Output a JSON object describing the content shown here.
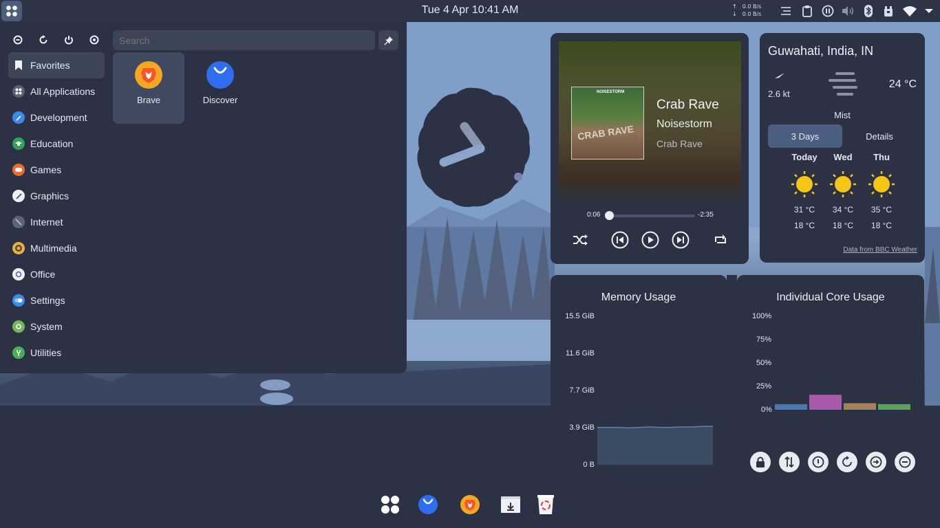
{
  "topbar": {
    "datetime": "Tue 4 Apr  10:41 AM",
    "net_up": "0.0 B/s",
    "net_down": "0.0 B/s",
    "tray_icons": [
      "notes-icon",
      "clipboard-icon",
      "media-pause-icon",
      "volume-icon",
      "bluetooth-icon",
      "package-icon",
      "wifi-icon",
      "chevron-down-icon"
    ]
  },
  "launcher": {
    "search_placeholder": "Search",
    "power_buttons": [
      "logout-icon",
      "restart-icon",
      "shutdown-icon",
      "sleep-icon"
    ],
    "categories": [
      {
        "label": "Favorites",
        "icon": "bookmark-icon",
        "color": "#e6e9ef"
      },
      {
        "label": "All Applications",
        "icon": "apps-icon",
        "color": "#7d8597"
      },
      {
        "label": "Development",
        "icon": "hammer-icon",
        "color": "#3d8be8"
      },
      {
        "label": "Education",
        "icon": "graduation-icon",
        "color": "#2fa35b"
      },
      {
        "label": "Games",
        "icon": "gamepad-icon",
        "color": "#f06a2c"
      },
      {
        "label": "Graphics",
        "icon": "brush-icon",
        "color": "#e6e9ef"
      },
      {
        "label": "Internet",
        "icon": "globe-icon",
        "color": "#5c667a"
      },
      {
        "label": "Multimedia",
        "icon": "speaker-icon",
        "color": "#e6b34a"
      },
      {
        "label": "Office",
        "icon": "office-icon",
        "color": "#e6e9ef"
      },
      {
        "label": "Settings",
        "icon": "toggle-icon",
        "color": "#3d8be8"
      },
      {
        "label": "System",
        "icon": "gear-icon",
        "color": "#72b85a"
      },
      {
        "label": "Utilities",
        "icon": "wrench-icon",
        "color": "#4aae58"
      }
    ],
    "apps": [
      {
        "label": "Brave",
        "icon": "brave-icon"
      },
      {
        "label": "Discover",
        "icon": "discover-icon"
      }
    ]
  },
  "music": {
    "title": "Crab Rave",
    "artist": "Noisestorm",
    "album": "Crab Rave",
    "cover_brand": "NOISESTORM",
    "cover_text": "CRAB RAVE",
    "elapsed": "0:06",
    "remaining": "-2:35",
    "progress": 0.04
  },
  "weather": {
    "location": "Guwahati, India, IN",
    "wind": "2.6 kt",
    "temperature": "24 °C",
    "condition": "Mist",
    "tabs": [
      "3 Days",
      "Details"
    ],
    "days": [
      {
        "name": "Today",
        "hi": "31 °C",
        "lo": "18 °C"
      },
      {
        "name": "Wed",
        "hi": "34 °C",
        "lo": "18 °C"
      },
      {
        "name": "Thu",
        "hi": "35 °C",
        "lo": "18 °C"
      }
    ],
    "source": "Data from BBC Weather"
  },
  "memory": {
    "title": "Memory Usage",
    "ticks": [
      "15.5 GiB",
      "11.6 GiB",
      "7.7 GiB",
      "3.9 GiB",
      "0 B"
    ],
    "max_gib": 15.5,
    "samples_gib": [
      3.9,
      3.9,
      3.9,
      3.85,
      3.9,
      3.95,
      3.9,
      3.9,
      3.95,
      3.95,
      4.0,
      4.0
    ]
  },
  "cores": {
    "title": "Individual Core Usage",
    "ticks": [
      "100%",
      "75%",
      "50%",
      "25%",
      "0%"
    ],
    "values_pct": [
      6,
      16,
      7,
      6
    ],
    "colors": [
      "#4f79ad",
      "#a85aab",
      "#a58258",
      "#59a35a"
    ]
  },
  "session_buttons": [
    "lock-icon",
    "switch-user-icon",
    "shutdown-icon",
    "restart-icon",
    "logout-icon",
    "sleep-icon"
  ],
  "dock": [
    "app-launcher-icon",
    "discover-icon",
    "brave-icon",
    "downloads-icon",
    "trash-icon"
  ]
}
